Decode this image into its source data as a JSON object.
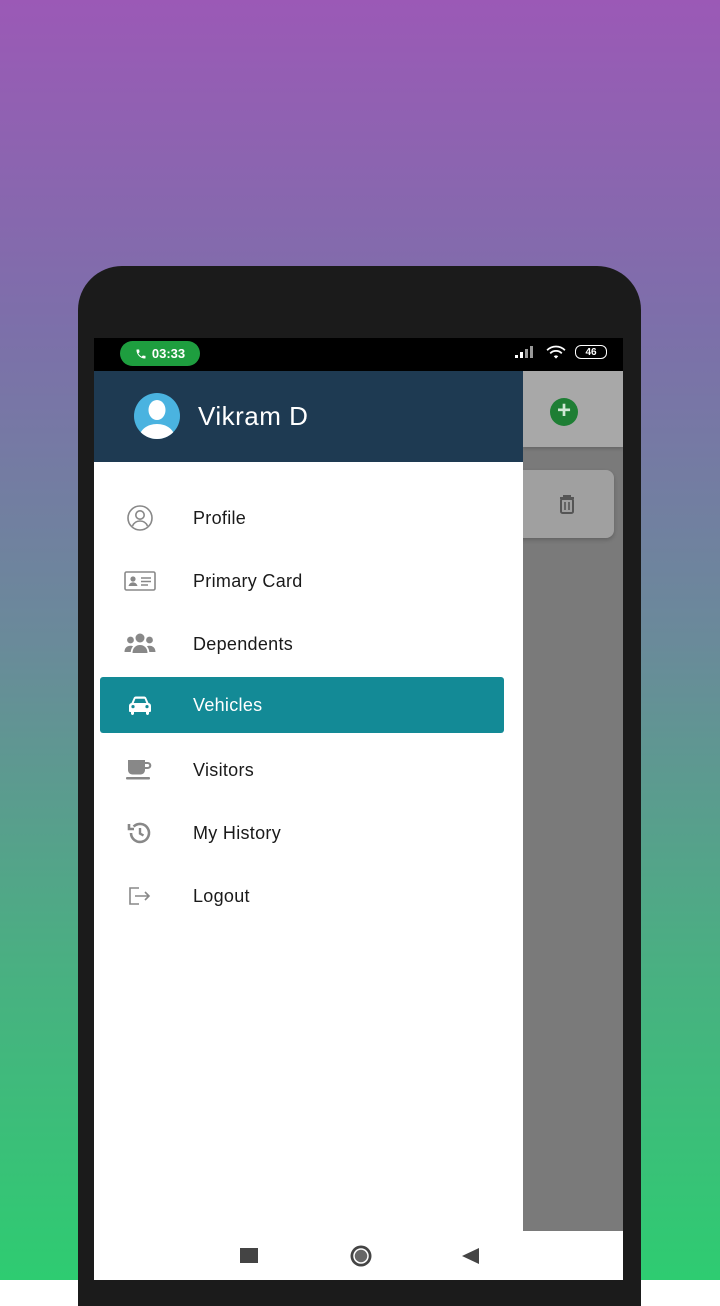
{
  "status_bar": {
    "call_time": "03:33",
    "battery": "46",
    "icons": [
      "phone-icon",
      "signal-icon",
      "wifi-icon",
      "battery-icon"
    ]
  },
  "drawer": {
    "header": {
      "user_name": "Vikram D",
      "avatar_icon": "avatar-icon",
      "background_color": "#1e3a52"
    },
    "items": [
      {
        "label": "Profile",
        "icon": "user-circle-icon",
        "active": false
      },
      {
        "label": "Primary Card",
        "icon": "id-card-icon",
        "active": false
      },
      {
        "label": "Dependents",
        "icon": "users-icon",
        "active": false
      },
      {
        "label": "Vehicles",
        "icon": "car-icon",
        "active": true
      },
      {
        "label": "Visitors",
        "icon": "coffee-cup-icon",
        "active": false
      },
      {
        "label": "My History",
        "icon": "history-icon",
        "active": false
      },
      {
        "label": "Logout",
        "icon": "logout-icon",
        "active": false
      }
    ],
    "active_color": "#138a96"
  },
  "background_app": {
    "add_icon": "add-icon",
    "delete_icon": "trash-icon"
  },
  "nav_bar": {
    "buttons": [
      "recent-apps-icon",
      "home-icon",
      "back-icon"
    ]
  }
}
